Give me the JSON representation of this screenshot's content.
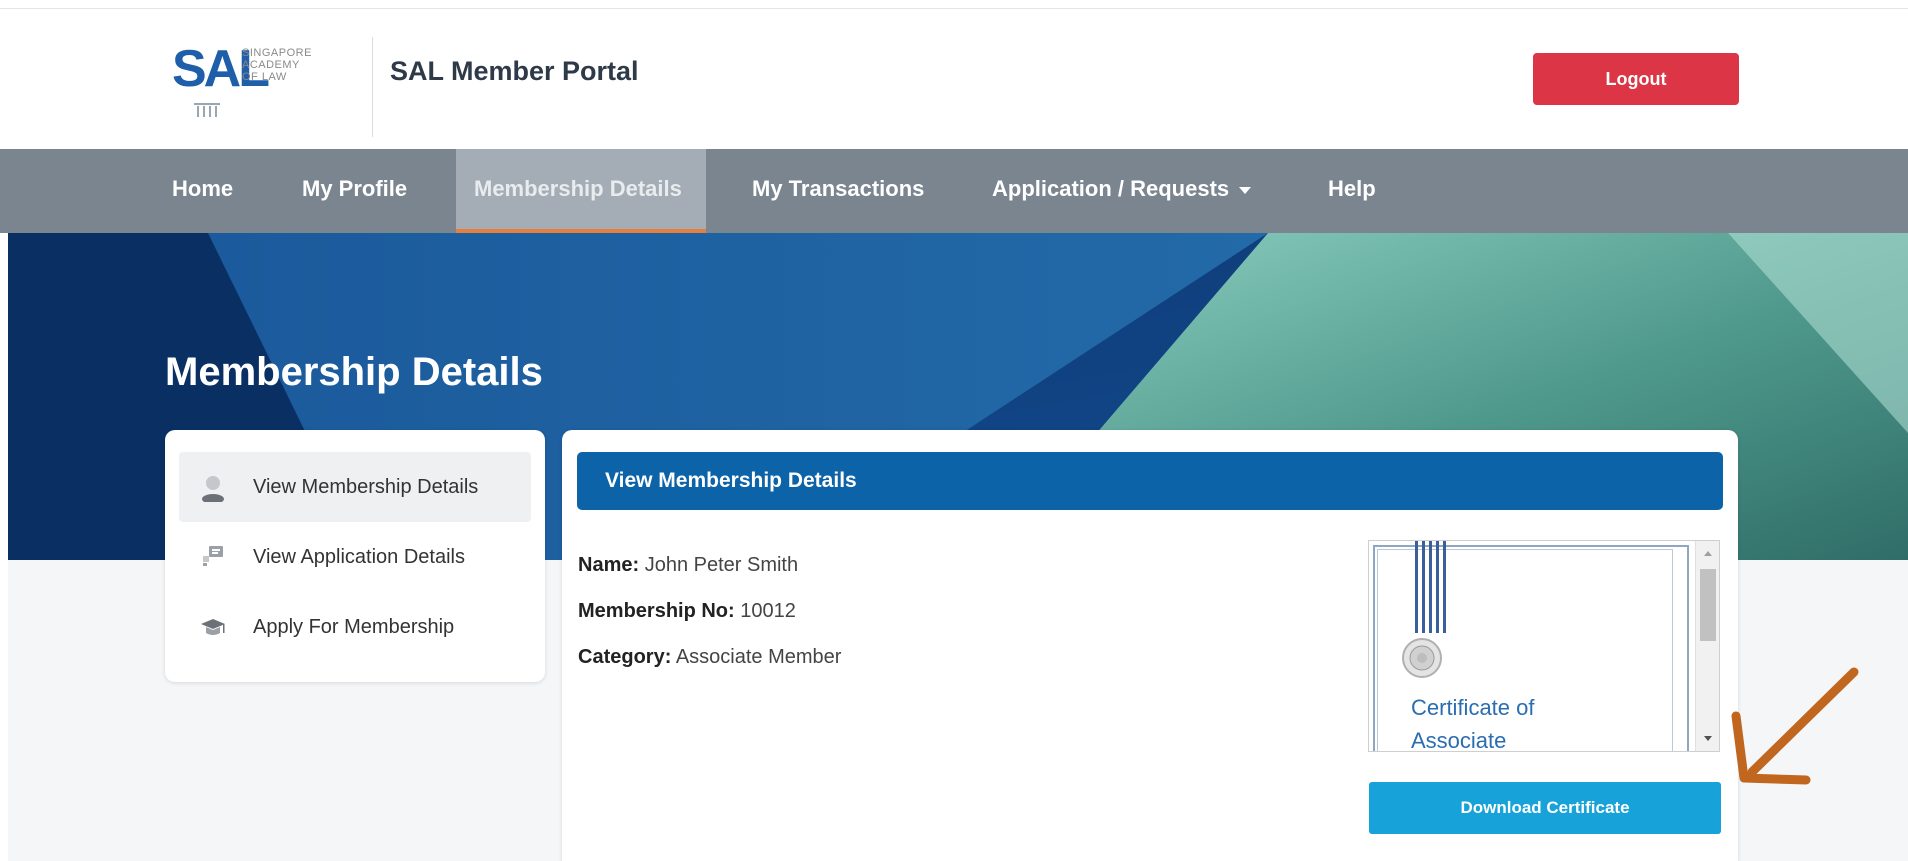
{
  "header": {
    "logo_text": "SAL",
    "logo_subtext": "SINGAPORE\nACADEMY\nOF LAW",
    "portal_title": "SAL Member Portal",
    "logout_label": "Logout"
  },
  "nav": {
    "items": [
      {
        "label": "Home"
      },
      {
        "label": "My Profile"
      },
      {
        "label": "Membership Details",
        "active": true
      },
      {
        "label": "My Transactions"
      },
      {
        "label": "Application / Requests"
      },
      {
        "label": "Help"
      }
    ]
  },
  "banner": {
    "title": "Membership Details"
  },
  "sidebar": {
    "items": [
      {
        "label": "View Membership Details",
        "icon": "person-icon",
        "active": true
      },
      {
        "label": "View Application Details",
        "icon": "chat-icon"
      },
      {
        "label": "Apply For Membership",
        "icon": "graduation-cap-icon"
      }
    ]
  },
  "main": {
    "card_title": "View Membership Details",
    "fields": {
      "name_label": "Name:",
      "name_value": "John Peter Smith",
      "membership_no_label": "Membership No:",
      "membership_no_value": "10012",
      "category_label": "Category:",
      "category_value": "Associate Member"
    },
    "certificate": {
      "preview_text": "Certificate of\nAssociate"
    },
    "download_label": "Download Certificate"
  },
  "colors": {
    "nav_bg": "#7a8590",
    "logout": "#dc3545",
    "card_header": "#0d63a8",
    "download": "#17a2d9",
    "nav_active_underline": "#e57f3d",
    "annotation_arrow": "#c0661f"
  }
}
